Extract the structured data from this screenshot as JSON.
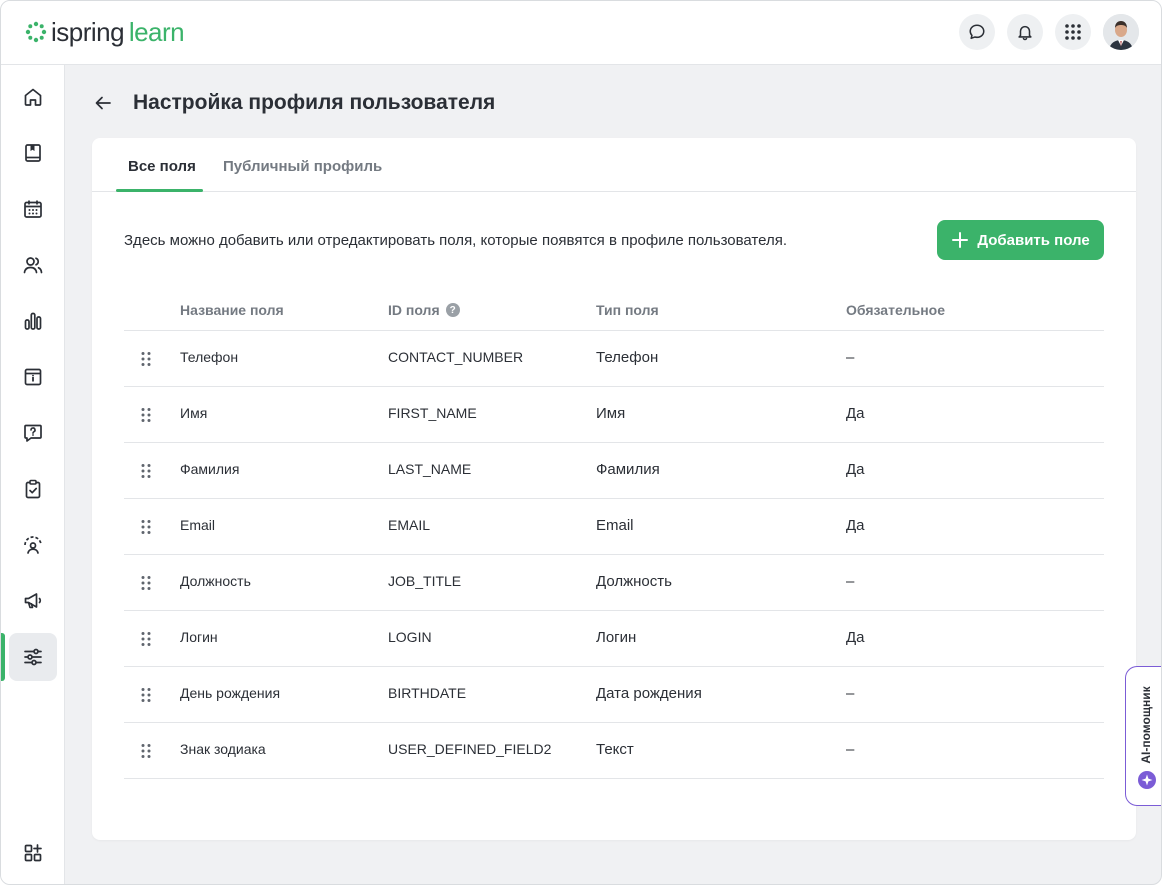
{
  "brand": {
    "logo_part1": "ispring",
    "logo_part2": "learn",
    "accent_color": "#3bb36a",
    "ai_color": "#7b5cd6"
  },
  "header": {
    "actions": [
      {
        "icon": "chat-icon"
      },
      {
        "icon": "bell-icon"
      },
      {
        "icon": "apps-grid-icon"
      },
      {
        "icon": "avatar"
      }
    ]
  },
  "sidebar": {
    "items": [
      {
        "icon": "home-icon"
      },
      {
        "icon": "book-icon"
      },
      {
        "icon": "calendar-icon"
      },
      {
        "icon": "users-icon"
      },
      {
        "icon": "bar-chart-icon"
      },
      {
        "icon": "info-board-icon"
      },
      {
        "icon": "question-chat-icon"
      },
      {
        "icon": "clipboard-check-icon"
      },
      {
        "icon": "user-feedback-icon"
      },
      {
        "icon": "megaphone-icon"
      },
      {
        "icon": "settings-sliders-icon",
        "active": true
      },
      {
        "icon": "add-widgets-icon"
      }
    ]
  },
  "page": {
    "title": "Настройка профиля пользователя",
    "tabs": [
      {
        "label": "Все поля",
        "active": true
      },
      {
        "label": "Публичный профиль",
        "active": false
      }
    ],
    "description": "Здесь можно добавить или отредактировать поля, которые появятся в профиле пользователя.",
    "add_button_label": "Добавить поле"
  },
  "table": {
    "columns": [
      "Название поля",
      "ID поля",
      "Тип поля",
      "Обязательное"
    ],
    "id_help_icon": "?",
    "rows": [
      {
        "name": "Телефон",
        "id": "CONTACT_NUMBER",
        "type": "Телефон",
        "required": "–"
      },
      {
        "name": "Имя",
        "id": "FIRST_NAME",
        "type": "Имя",
        "required": "Да"
      },
      {
        "name": "Фамилия",
        "id": "LAST_NAME",
        "type": "Фамилия",
        "required": "Да"
      },
      {
        "name": "Email",
        "id": "EMAIL",
        "type": "Email",
        "required": "Да"
      },
      {
        "name": "Должность",
        "id": "JOB_TITLE",
        "type": "Должность",
        "required": "–"
      },
      {
        "name": "Логин",
        "id": "LOGIN",
        "type": "Логин",
        "required": "Да"
      },
      {
        "name": "День рождения",
        "id": "BIRTHDATE",
        "type": "Дата рождения",
        "required": "–"
      },
      {
        "name": "Знак зодиака",
        "id": "USER_DEFINED_FIELD2",
        "type": "Текст",
        "required": "–"
      }
    ]
  },
  "ai_assistant": {
    "label": "AI-помощник"
  }
}
